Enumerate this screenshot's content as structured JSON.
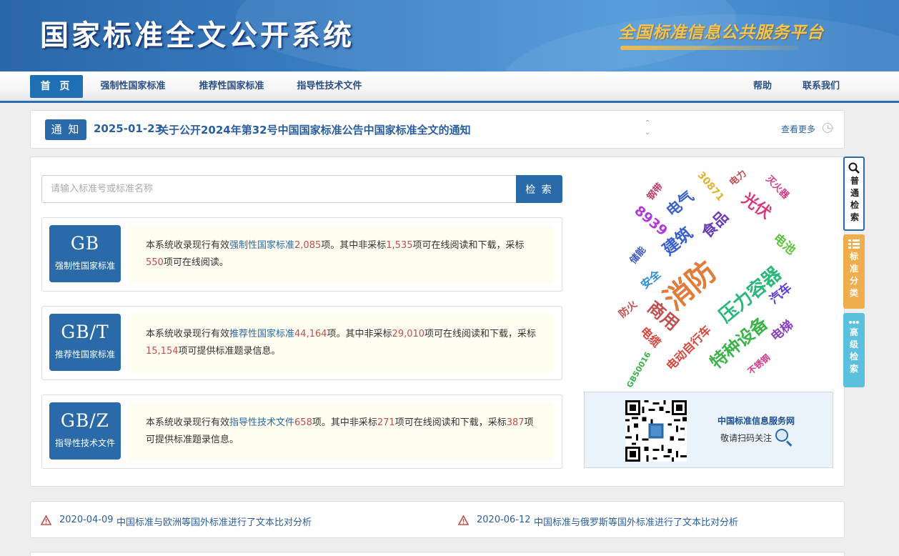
{
  "header": {
    "title": "国家标准全文公开系统",
    "slogan": "全国标准信息公共服务平台"
  },
  "nav": {
    "home": "首 页",
    "mandatory": "强制性国家标准",
    "recommended": "推荐性国家标准",
    "guidance": "指导性技术文件",
    "help": "帮助",
    "contact": "联系我们"
  },
  "notice": {
    "badge": "通 知",
    "date": "2025-01-23",
    "text": "关于公开2024年第32号中国国家标准公告中国家标准全文的通知",
    "more": "查看更多"
  },
  "search": {
    "placeholder": "请输入标准号或标准名称",
    "button": "检 索"
  },
  "standards": [
    {
      "code": "GB",
      "label": "强制性国家标准",
      "p1": "本系统收录现行有效",
      "type": "强制性国家标准",
      "total": "2,085",
      "p2": "项。其中非采标",
      "online": "1,535",
      "p3": "项可在线阅读和下载，采标",
      "other": "550",
      "p4": "项可在线阅读。"
    },
    {
      "code": "GB/T",
      "label": "推荐性国家标准",
      "p1": "本系统收录现行有效",
      "type": "推荐性国家标准",
      "total": "44,164",
      "p2": "项。其中非采标",
      "online": "29,010",
      "p3": "项可在线阅读和下载，采标",
      "other": "15,154",
      "p4": "项可提供标准题录信息。"
    },
    {
      "code": "GB/Z",
      "label": "指导性技术文件",
      "p1": "本系统收录现行有效",
      "type": "指导性技术文件",
      "total": "658",
      "p2": "项。其中非采标",
      "online": "271",
      "p3": "项可在线阅读和下载，采标",
      "other": "387",
      "p4": "项可提供标准题录信息。"
    }
  ],
  "word_cloud": [
    {
      "text": "消防",
      "color": "#e07b39"
    },
    {
      "text": "压力容器",
      "color": "#2ab87a"
    },
    {
      "text": "特种设备",
      "color": "#3bb34a"
    },
    {
      "text": "建筑",
      "color": "#3a5fcd"
    },
    {
      "text": "食品",
      "color": "#6a3db8"
    },
    {
      "text": "电气",
      "color": "#3a62c9"
    },
    {
      "text": "光伏",
      "color": "#d63a7a"
    },
    {
      "text": "8939",
      "color": "#b03ad4"
    },
    {
      "text": "商用",
      "color": "#c0504d"
    },
    {
      "text": "电动自行车",
      "color": "#d9453b"
    },
    {
      "text": "电梯",
      "color": "#8a3fbf"
    },
    {
      "text": "汽车",
      "color": "#5b3dd4"
    },
    {
      "text": "电池",
      "color": "#5cc43a"
    },
    {
      "text": "安全",
      "color": "#2a8ad4"
    },
    {
      "text": "储能",
      "color": "#3a56c2"
    },
    {
      "text": "防火",
      "color": "#c0504d"
    },
    {
      "text": "电缆",
      "color": "#d9453b"
    },
    {
      "text": "GB50016",
      "color": "#3bb34a"
    },
    {
      "text": "不锈钢",
      "color": "#d43a8a"
    },
    {
      "text": "30871",
      "color": "#e0b430"
    },
    {
      "text": "电力",
      "color": "#c0504d"
    },
    {
      "text": "灭火器",
      "color": "#d43a8a"
    },
    {
      "text": "钢带",
      "color": "#c03a6a"
    }
  ],
  "qr": {
    "title": "中国标准信息服务网",
    "subtitle": "敬请扫码关注"
  },
  "side_tabs": {
    "basic": "普通检索",
    "classification": "标准分类",
    "advanced": "高级检索"
  },
  "news": [
    {
      "date": "2020-04-09",
      "text": "中国标准与欧洲等国外标准进行了文本比对分析"
    },
    {
      "date": "2020-06-12",
      "text": "中国标准与俄罗斯等国外标准进行了文本比对分析"
    }
  ],
  "colors": {
    "primary": "#2a6aa8",
    "highlight_number": "#c0504d",
    "slogan": "#f5c44a",
    "classify_tab": "#f0ad4e",
    "advanced_tab": "#5bc0de"
  }
}
